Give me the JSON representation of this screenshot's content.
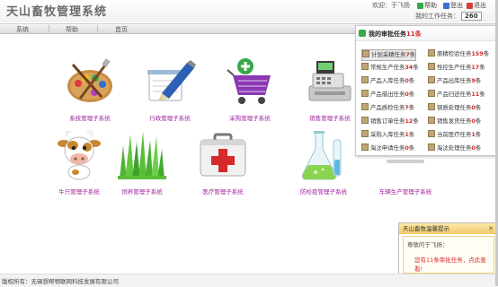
{
  "header": {
    "title": "天山畜牧管理系统",
    "welcome": "欢迎：于飞扬",
    "links": [
      {
        "label": "帮助",
        "icon": "help-icon",
        "color": "#3aa64a"
      },
      {
        "label": "登出",
        "icon": "logout-icon",
        "color": "#3a6fd1"
      },
      {
        "label": "退出",
        "icon": "exit-icon",
        "color": "#d1403a"
      }
    ],
    "daily_task_label": "我的工作任务：",
    "daily_task_count": "260"
  },
  "nav": {
    "items": [
      "系统",
      "帮助",
      "首页"
    ]
  },
  "modules": [
    {
      "label": "系统管理子系统",
      "icon": "palette-icon"
    },
    {
      "label": "行政管理子系统",
      "icon": "pen-notepad-icon"
    },
    {
      "label": "采购管理子系统",
      "icon": "shopping-cart-icon"
    },
    {
      "label": "销售管理子系统",
      "icon": "cash-register-icon"
    },
    {
      "label": "牛只管理子系统",
      "icon": "cow-icon"
    },
    {
      "label": "饲养管理子系统",
      "icon": "grass-icon"
    },
    {
      "label": "医疗管理子系统",
      "icon": "first-aid-kit-icon"
    },
    {
      "label": "防检疫管理子系统",
      "icon": "lab-flask-icon"
    },
    {
      "label": "车辆生产管理子系统",
      "icon": "vehicle-icon"
    }
  ],
  "task_panel": {
    "title_prefix": "我的审批任务",
    "title_count": "11条",
    "items_left": [
      {
        "pre": "计划采精任务",
        "num": "7",
        "post": "条",
        "selected": true
      },
      {
        "pre": "常规生产任务",
        "num": "34",
        "post": "条"
      },
      {
        "pre": "产品入库任务",
        "num": "0",
        "post": "条"
      },
      {
        "pre": "产品借出任务",
        "num": "0",
        "post": "条"
      },
      {
        "pre": "产品质检任务",
        "num": "7",
        "post": "条"
      },
      {
        "pre": "销售订单任务",
        "num": "12",
        "post": "条"
      },
      {
        "pre": "采购入库任务",
        "num": "1",
        "post": "条"
      },
      {
        "pre": "淘汰申请任务",
        "num": "0",
        "post": "条"
      }
    ],
    "items_right": [
      {
        "pre": "原精检验任务",
        "num": "159",
        "post": "条"
      },
      {
        "pre": "性控生产任务",
        "num": "17",
        "post": "条"
      },
      {
        "pre": "产品出库任务",
        "num": "9",
        "post": "条"
      },
      {
        "pre": "产品归还任务",
        "num": "11",
        "post": "条"
      },
      {
        "pre": "铜质处理任务",
        "num": "0",
        "post": "条"
      },
      {
        "pre": "销售发货任务",
        "num": "0",
        "post": "条"
      },
      {
        "pre": "当前医疗任务",
        "num": "1",
        "post": "条"
      },
      {
        "pre": "淘汰处理任务",
        "num": "0",
        "post": "条"
      }
    ]
  },
  "notice": {
    "title": "天山畜牧温馨提示",
    "close": "✕",
    "greeting": "尊敬的于飞扬：",
    "message": "您有11条审批任务，点此查看!"
  },
  "footer": {
    "text": "版权所有：无锡想帮物联网科技发展有限公司"
  }
}
